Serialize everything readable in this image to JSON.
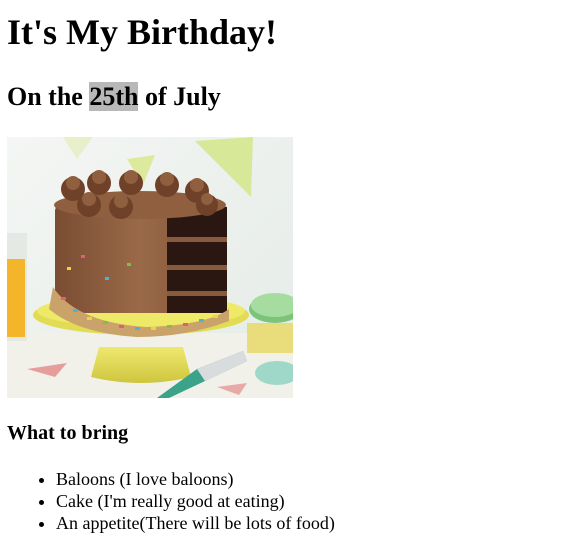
{
  "header": {
    "title": "It's My Birthday!"
  },
  "date": {
    "prefix": "On the ",
    "highlight": "25th",
    "suffix": " of July"
  },
  "image": {
    "subject": "chocolate birthday cake on a yellow cake stand",
    "colors": {
      "frosting": "#8a5a3c",
      "sponge": "#2b1a14",
      "stand": "#e6e05a",
      "background": "#eef2f0"
    }
  },
  "bring": {
    "heading": "What to bring",
    "items": [
      "Baloons (I love baloons)",
      "Cake (I'm really good at eating)",
      "An appetite(There will be lots of food)"
    ]
  }
}
